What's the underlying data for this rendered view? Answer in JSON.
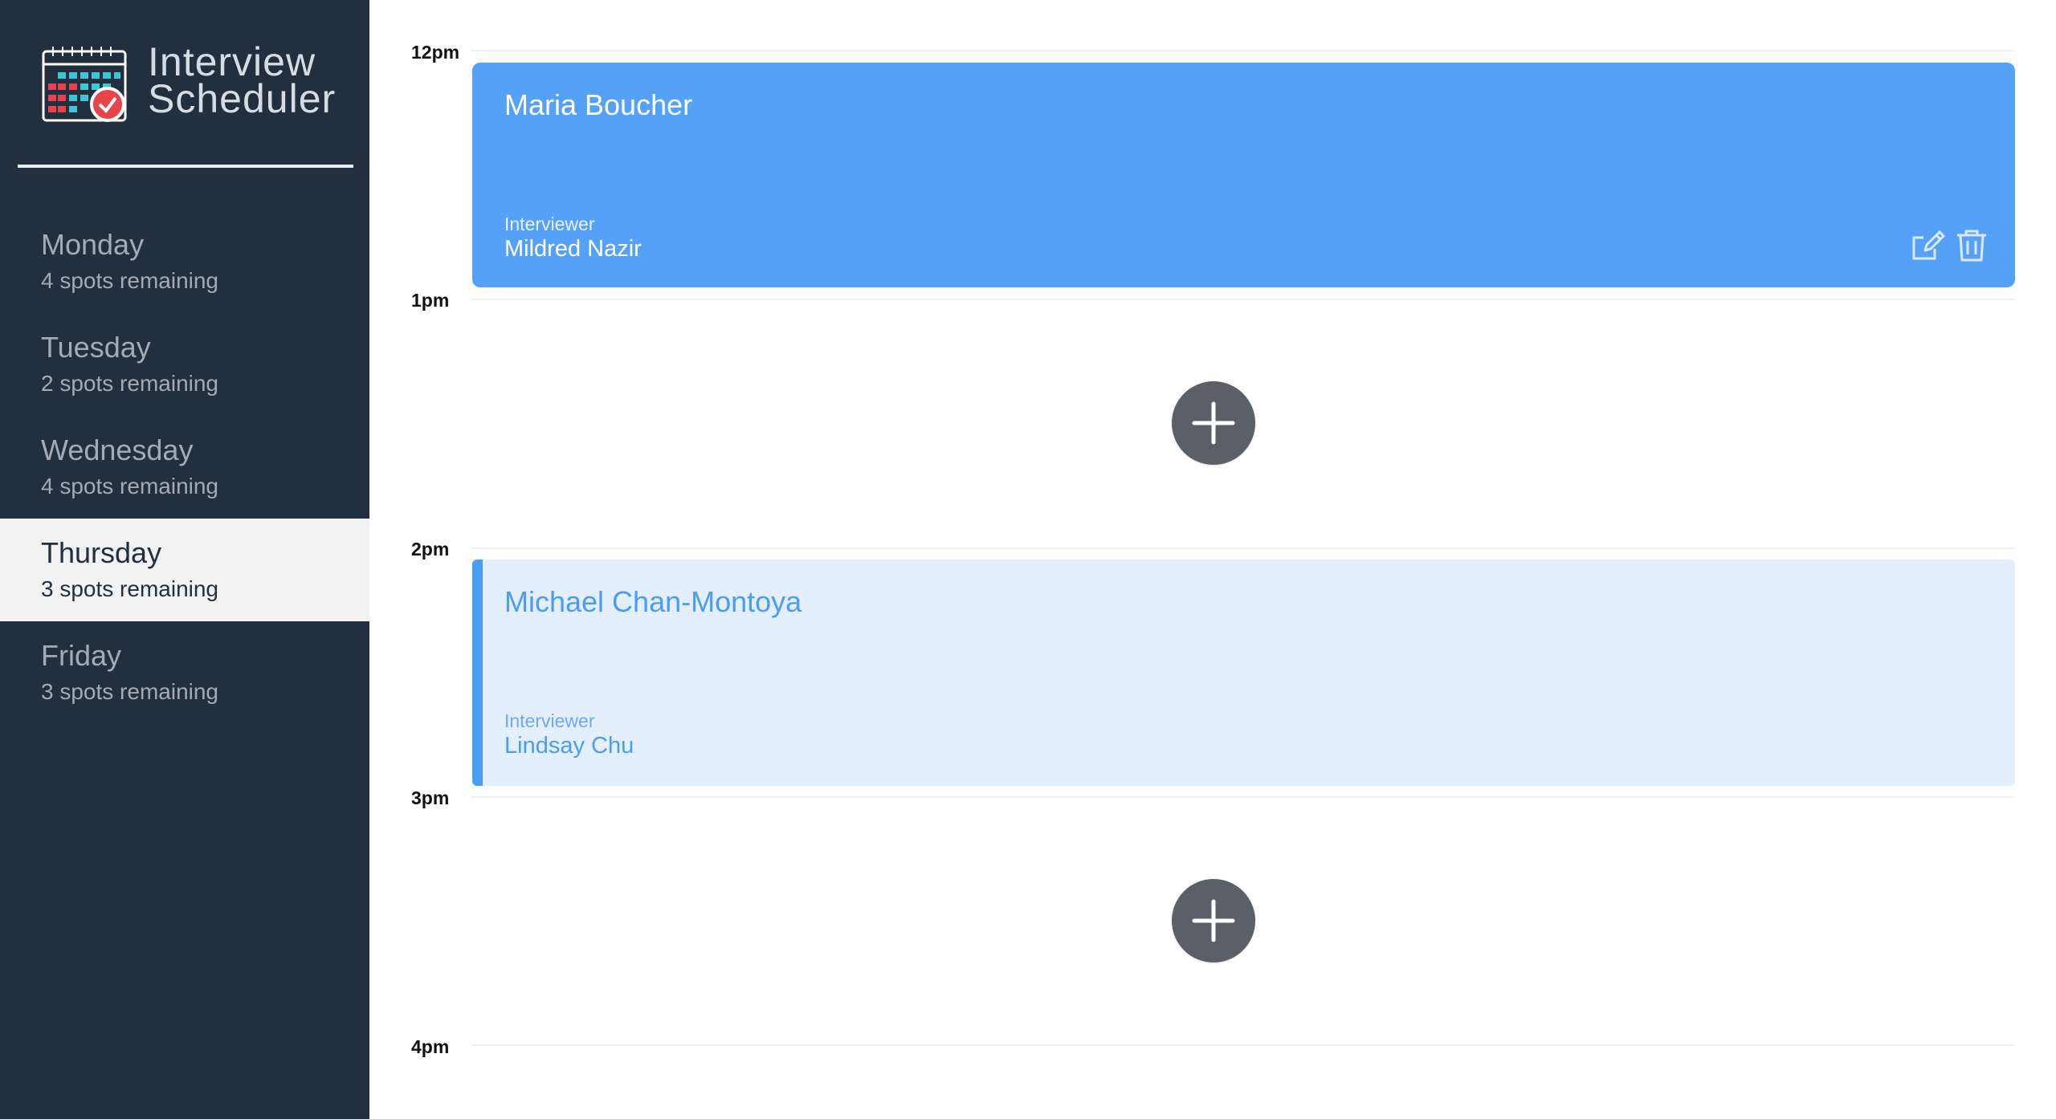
{
  "brand": {
    "title_line1": "Interview",
    "title_line2": "Scheduler",
    "logo_icon": "calendar-check-icon"
  },
  "sidebar": {
    "days": [
      {
        "name": "Monday",
        "spots": "4 spots remaining",
        "selected": false
      },
      {
        "name": "Tuesday",
        "spots": "2 spots remaining",
        "selected": false
      },
      {
        "name": "Wednesday",
        "spots": "4 spots remaining",
        "selected": false
      },
      {
        "name": "Thursday",
        "spots": "3 spots remaining",
        "selected": true
      },
      {
        "name": "Friday",
        "spots": "3 spots remaining",
        "selected": false
      }
    ]
  },
  "schedule": {
    "times": [
      "12pm",
      "1pm",
      "2pm",
      "3pm",
      "4pm"
    ],
    "appointments": [
      {
        "student": "Maria Boucher",
        "interviewer_label": "Interviewer",
        "interviewer": "Mildred Nazir",
        "style": "booked",
        "actions": [
          "edit-icon",
          "trash-icon"
        ]
      },
      {
        "type": "empty",
        "add_icon": "plus-icon"
      },
      {
        "student": "Michael Chan-Montoya",
        "interviewer_label": "Interviewer",
        "interviewer": "Lindsay Chu",
        "style": "highlighted"
      },
      {
        "type": "empty",
        "add_icon": "plus-icon"
      }
    ]
  },
  "colors": {
    "sidebar_bg": "#222f3e",
    "booked_bg": "#56a1f8",
    "highlight_bg": "#e3effc",
    "highlight_accent": "#4a9cf5",
    "add_button": "#5b5f66"
  }
}
